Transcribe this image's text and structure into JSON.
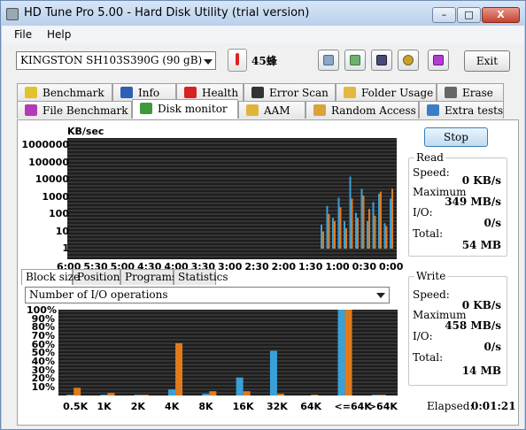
{
  "window": {
    "title": "HD Tune Pro 5.00 - Hard Disk Utility (trial version)",
    "min_label": "–",
    "max_label": "□",
    "close_label": "X"
  },
  "menu": {
    "file": "File",
    "help": "Help"
  },
  "toolbar": {
    "drive": "KINGSTON SH103S390G (90 gB)",
    "temperature": "45蜂",
    "exit_label": "Exit",
    "icons": [
      "copy-icon",
      "paste-icon",
      "save-icon",
      "settings-icon",
      "download-icon"
    ]
  },
  "tabs_row1": [
    {
      "label": "Benchmark",
      "icon": "benchmark-icon"
    },
    {
      "label": "Info",
      "icon": "info-icon"
    },
    {
      "label": "Health",
      "icon": "health-icon"
    },
    {
      "label": "Error Scan",
      "icon": "error-scan-icon"
    },
    {
      "label": "Folder Usage",
      "icon": "folder-icon"
    },
    {
      "label": "Erase",
      "icon": "trash-icon"
    }
  ],
  "tabs_row2": [
    {
      "label": "File Benchmark",
      "icon": "file-benchmark-icon"
    },
    {
      "label": "Disk monitor",
      "icon": "disk-monitor-icon"
    },
    {
      "label": "AAM",
      "icon": "speaker-icon"
    },
    {
      "label": "Random Access",
      "icon": "random-access-icon"
    },
    {
      "label": "Extra tests",
      "icon": "extra-tests-icon"
    }
  ],
  "side": {
    "stop_label": "Stop",
    "read": {
      "title": "Read",
      "speed_label": "Speed:",
      "speed": "0 KB/s",
      "max_label": "Maximum",
      "max": "349 MB/s",
      "io_label": "I/O:",
      "io": "0/s",
      "total_label": "Total:",
      "total": "54 MB"
    },
    "write": {
      "title": "Write",
      "speed_label": "Speed:",
      "speed": "0 KB/s",
      "max_label": "Maximum",
      "max": "458 MB/s",
      "io_label": "I/O:",
      "io": "0/s",
      "total_label": "Total:",
      "total": "14 MB"
    },
    "elapsed_label": "Elapsed:",
    "elapsed": "0:01:21"
  },
  "subtabs": [
    "Block size",
    "Position",
    "Programs",
    "Statistics"
  ],
  "combo_value": "Number of I/O operations",
  "colors": {
    "read": "#3aa0d8",
    "write": "#e07a1c",
    "plot_bg": "#1d1d1d"
  },
  "chart_data": [
    {
      "type": "bar",
      "title": "KB/sec",
      "scale": "log",
      "y_ticks": [
        "1000000",
        "100000",
        "10000",
        "1000",
        "100",
        "10",
        "1"
      ],
      "x_ticks": [
        "6:00",
        "5:30",
        "5:00",
        "4:30",
        "4:00",
        "3:30",
        "3:00",
        "2:30",
        "2:00",
        "1:30",
        "1:00",
        "0:30",
        "0:00"
      ],
      "series": [
        {
          "values": [
            25,
            300,
            60,
            900,
            40,
            15000,
            120,
            3000,
            40,
            500,
            1500,
            30,
            800
          ]
        },
        {
          "values": [
            10,
            100,
            40,
            250,
            15,
            800,
            60,
            1200,
            200,
            80,
            2000,
            20,
            3000
          ]
        }
      ]
    },
    {
      "type": "bar",
      "y_ticks": [
        "100%",
        "90%",
        "80%",
        "70%",
        "60%",
        "50%",
        "40%",
        "30%",
        "20%",
        "10%"
      ],
      "categories": [
        "0.5K",
        "1K",
        "2K",
        "4K",
        "8K",
        "16K",
        "32K",
        "64K",
        "<=64K",
        ">64K"
      ],
      "series": [
        {
          "values": [
            1,
            1,
            1,
            7,
            2,
            21,
            52,
            0,
            100,
            1
          ]
        },
        {
          "values": [
            9,
            3,
            1,
            61,
            5,
            5,
            2,
            1,
            100,
            1
          ]
        }
      ]
    }
  ]
}
